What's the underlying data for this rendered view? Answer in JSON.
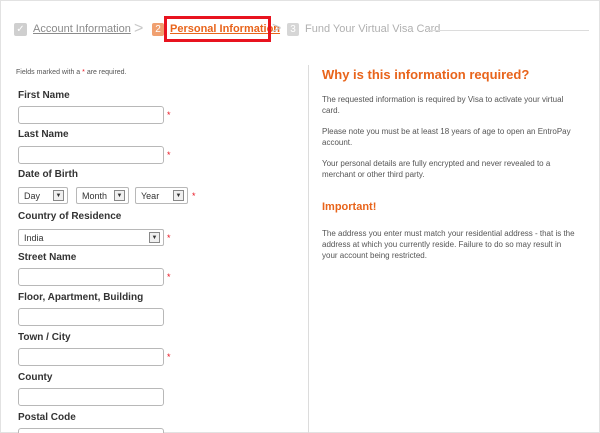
{
  "steps": {
    "step1": {
      "label": "Account Information"
    },
    "step2": {
      "number": "2",
      "label": "Personal Information"
    },
    "step3": {
      "number": "3",
      "label": "Fund Your Virtual Visa Card"
    }
  },
  "form": {
    "note_prefix": "Fields marked with a ",
    "note_star": "*",
    "note_suffix": " are required.",
    "required_mark": "*",
    "first_name": {
      "label": "First Name",
      "value": ""
    },
    "last_name": {
      "label": "Last Name",
      "value": ""
    },
    "dob": {
      "label": "Date of Birth",
      "day": "Day",
      "month": "Month",
      "year": "Year"
    },
    "country": {
      "label": "Country of Residence",
      "value": "India"
    },
    "street": {
      "label": "Street Name",
      "value": ""
    },
    "floor": {
      "label": "Floor, Apartment, Building",
      "value": ""
    },
    "town": {
      "label": "Town / City",
      "value": ""
    },
    "county": {
      "label": "County",
      "value": ""
    },
    "postal": {
      "label": "Postal Code",
      "value": ""
    }
  },
  "info": {
    "heading1": "Why is this information required?",
    "p1": "The requested information is required by Visa to activate your virtual card.",
    "p2": "Please note you must be at least 18 years of age to open an EntroPay account.",
    "p3": "Your personal details are fully encrypted and never revealed to a merchant or other third party.",
    "heading2": "Important!",
    "p4": "The address you enter must match your residential address - that is the address at which you currently reside. Failure to do so may result in your account being restricted."
  }
}
